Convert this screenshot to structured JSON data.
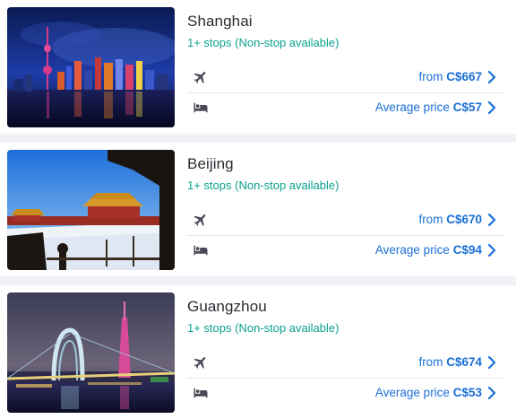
{
  "colors": {
    "accent": "#1a6fd6",
    "stops_green": "#0aa28e",
    "text": "#2b2b33",
    "icon": "#4a4a57",
    "divider": "#e6e7ef"
  },
  "destinations": [
    {
      "city": "Shanghai",
      "stops": "1+ stops (Non-stop available)",
      "flight": {
        "prefix": "from",
        "price": "C$667",
        "icon": "airplane-icon"
      },
      "hotel": {
        "prefix": "Average price",
        "price": "C$57",
        "icon": "bed-icon"
      },
      "image": "shanghai-skyline-night-photo"
    },
    {
      "city": "Beijing",
      "stops": "1+ stops (Non-stop available)",
      "flight": {
        "prefix": "from",
        "price": "C$670",
        "icon": "airplane-icon"
      },
      "hotel": {
        "prefix": "Average price",
        "price": "C$94",
        "icon": "bed-icon"
      },
      "image": "beijing-forbidden-city-snow-photo"
    },
    {
      "city": "Guangzhou",
      "stops": "1+ stops (Non-stop available)",
      "flight": {
        "prefix": "from",
        "price": "C$674",
        "icon": "airplane-icon"
      },
      "hotel": {
        "prefix": "Average price",
        "price": "C$53",
        "icon": "bed-icon"
      },
      "image": "guangzhou-bridge-tower-night-photo"
    }
  ]
}
